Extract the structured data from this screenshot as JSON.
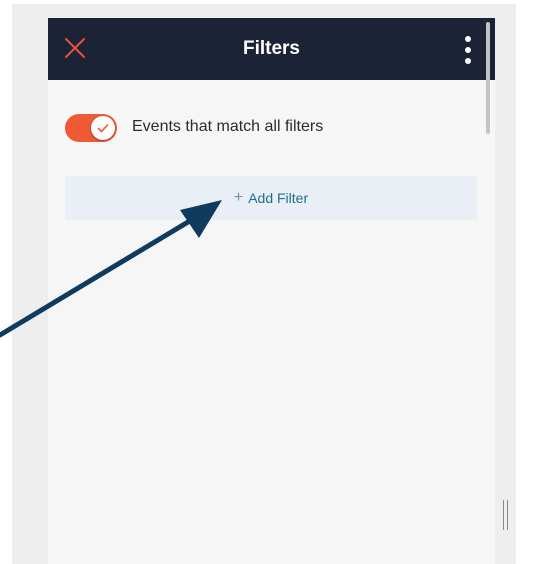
{
  "header": {
    "title": "Filters",
    "close_icon": "close-icon",
    "menu_icon": "more-vertical-icon"
  },
  "toggle": {
    "state": "on",
    "label": "Events that match all filters"
  },
  "add_filter": {
    "plus": "+",
    "label": "Add Filter"
  },
  "colors": {
    "header_bg": "#1d2336",
    "accent": "#ee5a33",
    "link": "#1f6f93",
    "add_filter_bg": "#e9eff4",
    "annotation_arrow": "#0f3b5f"
  }
}
